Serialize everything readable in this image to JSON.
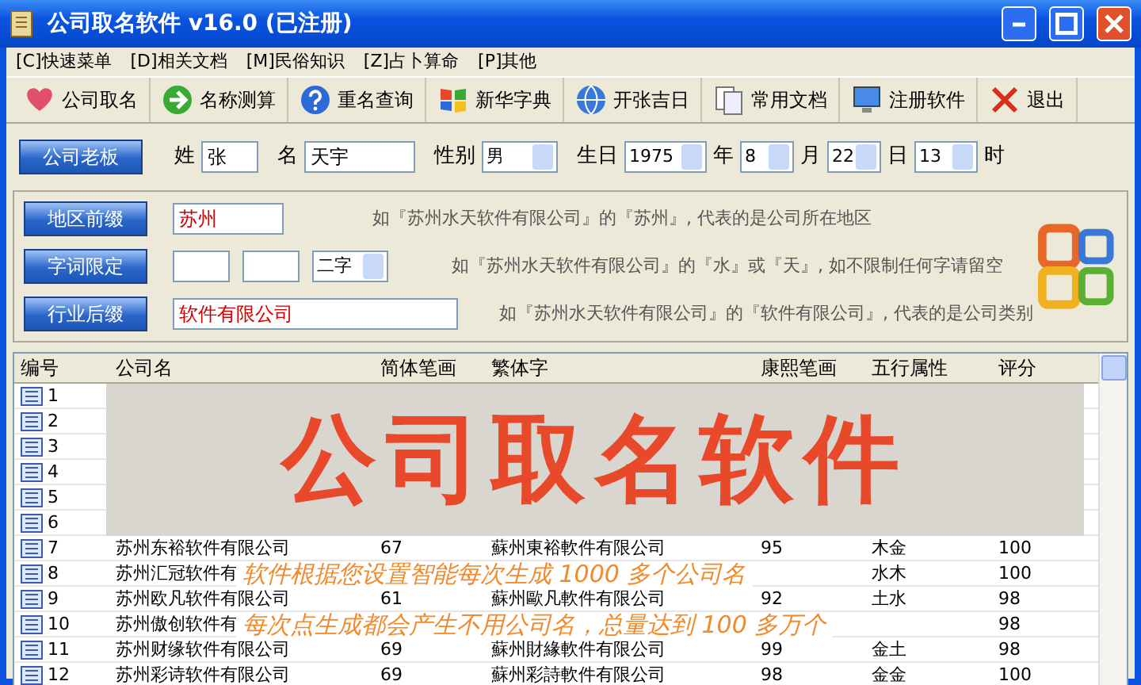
{
  "window": {
    "title": "公司取名软件 v16.0 (已注册)"
  },
  "menu": [
    "[C]快速菜单",
    "[D]相关文档",
    "[M]民俗知识",
    "[Z]占卜算命",
    "[P]其他"
  ],
  "toolbar": [
    {
      "label": "公司取名"
    },
    {
      "label": "名称测算"
    },
    {
      "label": "重名查询"
    },
    {
      "label": "新华字典"
    },
    {
      "label": "开张吉日"
    },
    {
      "label": "常用文档"
    },
    {
      "label": "注册软件"
    },
    {
      "label": "退出"
    }
  ],
  "owner": {
    "button": "公司老板",
    "fields": [
      {
        "kind": "text",
        "label": "姓",
        "value": "张"
      },
      {
        "kind": "text",
        "label": "名",
        "value": "天宇"
      },
      {
        "kind": "select",
        "label": "性别",
        "value": "男"
      }
    ],
    "birthday": {
      "label": "生日",
      "parts": [
        {
          "value": "1975",
          "unit": "年"
        },
        {
          "value": "8",
          "unit": "月"
        },
        {
          "value": "22",
          "unit": "日"
        },
        {
          "value": "13",
          "unit": "时"
        }
      ]
    }
  },
  "naming_rows": [
    {
      "button": "地区前缀",
      "fields": [
        {
          "kind": "text",
          "value": "苏州"
        }
      ],
      "hint": "如『苏州水天软件有限公司』的『苏州』, 代表的是公司所在地区"
    },
    {
      "button": "字词限定",
      "fields": [
        {
          "kind": "text"
        },
        {
          "kind": "text"
        },
        {
          "kind": "select",
          "value": "二字"
        }
      ],
      "hint": "如『苏州水天软件有限公司』的『水』或『天』, 如不限制任何字请留空"
    },
    {
      "button": "行业后缀",
      "fields": [
        {
          "kind": "wide",
          "value": "软件有限公司"
        }
      ],
      "hint": "如『苏州水天软件有限公司』的『软件有限公司』, 代表的是公司类别"
    }
  ],
  "table": {
    "columns": [
      "编号",
      "公司名",
      "简体笔画",
      "繁体字",
      "康熙笔画",
      "五行属性",
      "评分"
    ],
    "rows": [
      {
        "no": "1"
      },
      {
        "no": "2"
      },
      {
        "no": "3"
      },
      {
        "no": "4"
      },
      {
        "no": "5"
      },
      {
        "no": "6"
      },
      {
        "no": "7",
        "name": "苏州东裕软件有限公司",
        "simplified_strokes": "67",
        "traditional": "蘇州東裕軟件有限公司",
        "kangxi_strokes": "95",
        "wuxing": "木金",
        "score": "100"
      },
      {
        "no": "8",
        "name": "苏州汇冠软件有",
        "wuxing": "水木",
        "score": "100"
      },
      {
        "no": "9",
        "name": "苏州欧凡软件有限公司",
        "simplified_strokes": "61",
        "traditional": "蘇州歐凡軟件有限公司",
        "kangxi_strokes": "92",
        "wuxing": "土水",
        "score": "98"
      },
      {
        "no": "10",
        "name": "苏州傲创软件有",
        "score": "98"
      },
      {
        "no": "11",
        "name": "苏州财缘软件有限公司",
        "simplified_strokes": "69",
        "traditional": "蘇州財緣軟件有限公司",
        "kangxi_strokes": "99",
        "wuxing": "金土",
        "score": "98"
      },
      {
        "no": "12",
        "name": "苏州彩诗软件有限公司",
        "simplified_strokes": "69",
        "traditional": "蘇州彩詩軟件有限公司",
        "kangxi_strokes": "98",
        "wuxing": "金金",
        "score": "100"
      }
    ]
  },
  "promo_overlay": {
    "title": "公司取名软件",
    "lines": [
      "软件根据您设置智能每次生成 1000 多个公司名",
      "每次点生成都会产生不用公司名，总量达到 100 多万个"
    ]
  }
}
